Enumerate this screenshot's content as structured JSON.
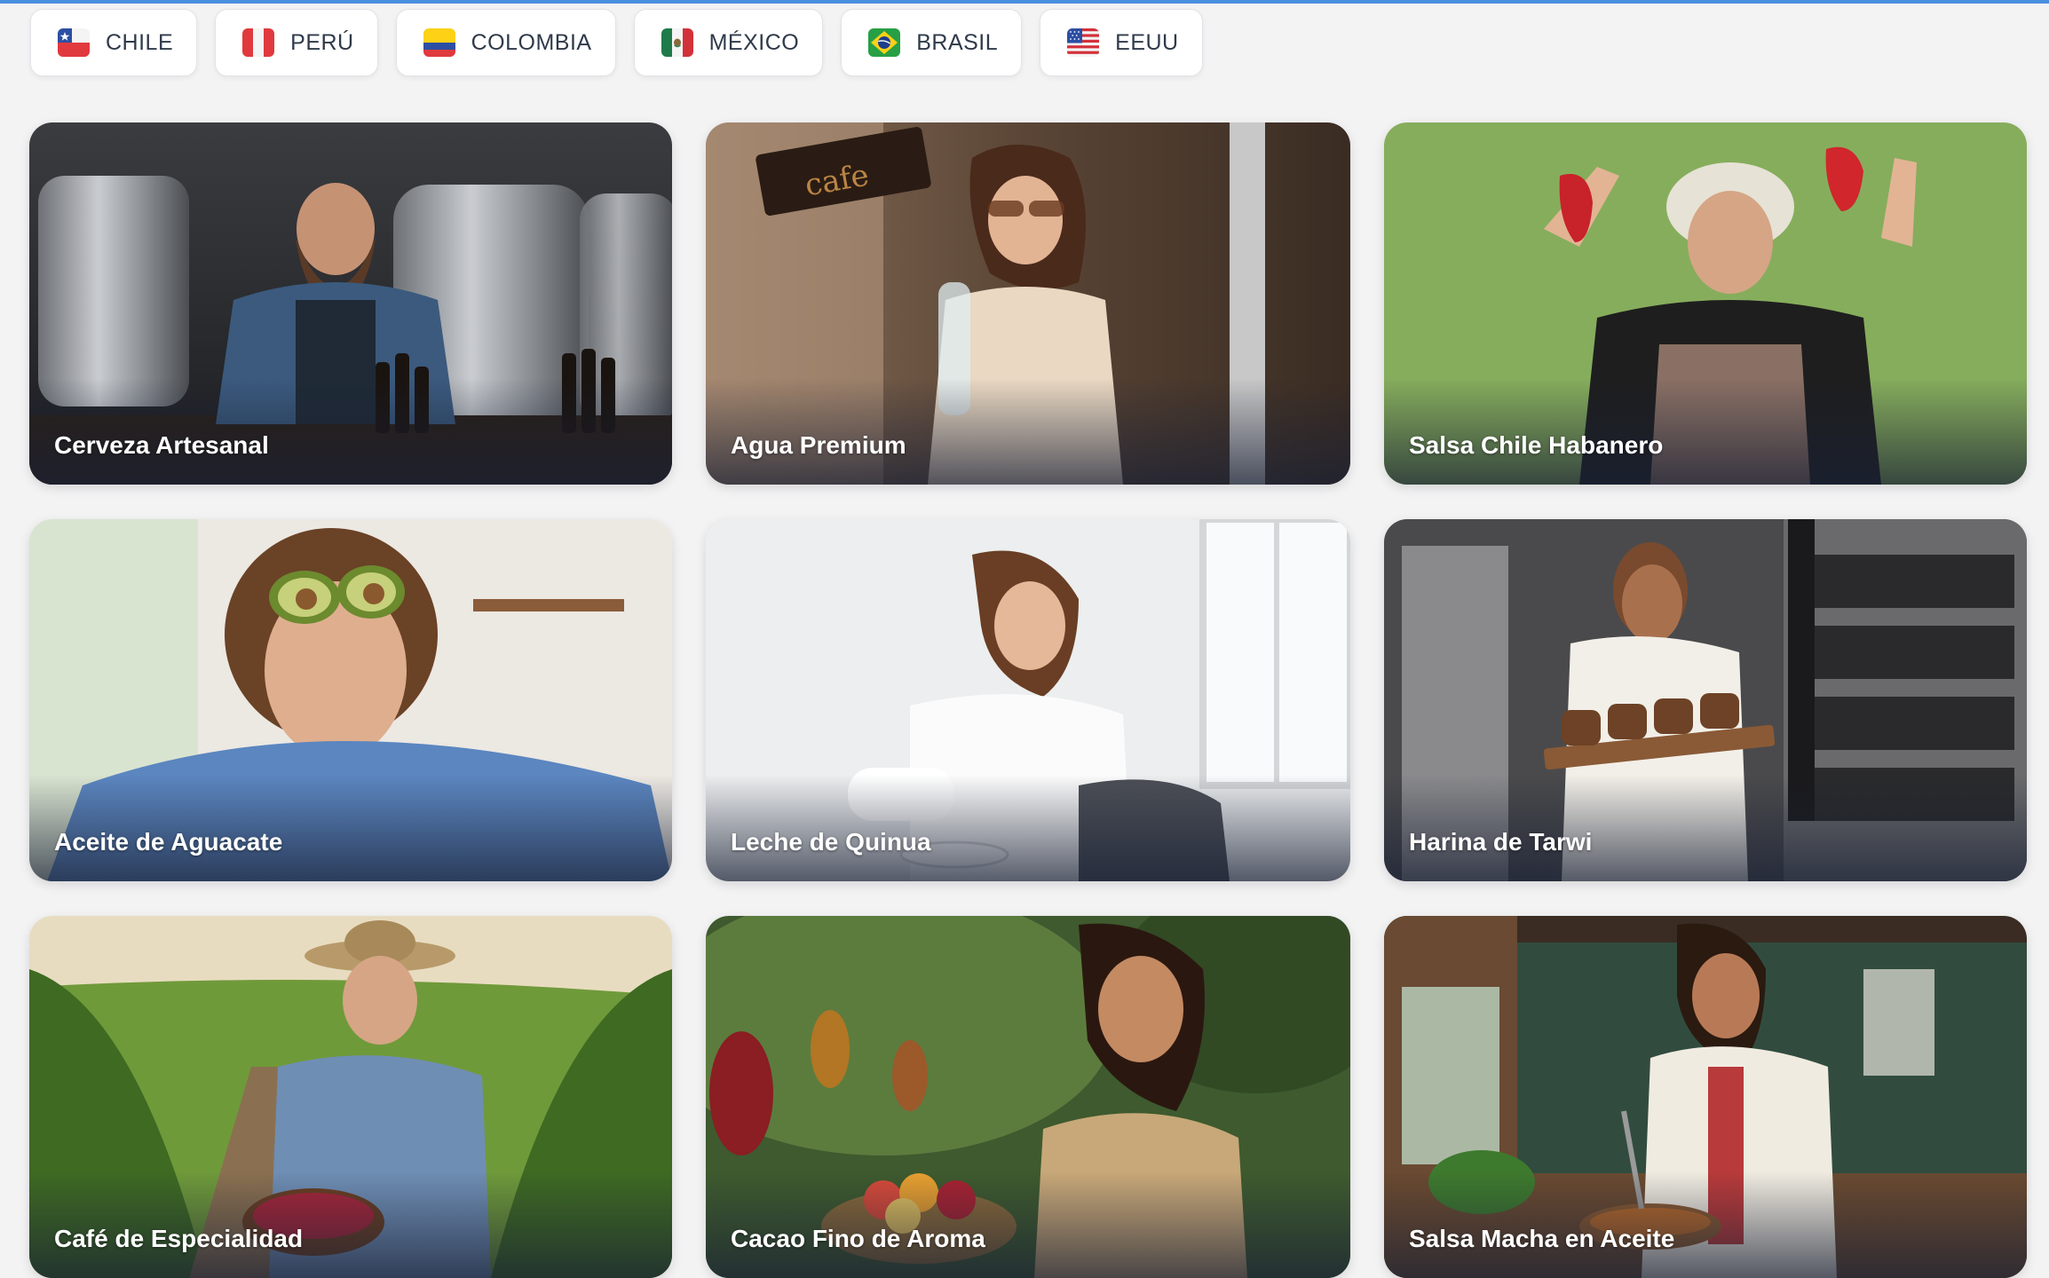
{
  "countries": [
    {
      "label": "CHILE",
      "icon": "chile-flag-icon"
    },
    {
      "label": "PERÚ",
      "icon": "peru-flag-icon"
    },
    {
      "label": "COLOMBIA",
      "icon": "colombia-flag-icon"
    },
    {
      "label": "MÉXICO",
      "icon": "mexico-flag-icon"
    },
    {
      "label": "BRASIL",
      "icon": "brasil-flag-icon"
    },
    {
      "label": "EEUU",
      "icon": "usa-flag-icon"
    }
  ],
  "products": [
    {
      "title": "Cerveza Artesanal"
    },
    {
      "title": "Agua Premium"
    },
    {
      "title": "Salsa Chile Habanero"
    },
    {
      "title": "Aceite de Aguacate"
    },
    {
      "title": "Leche de Quinua"
    },
    {
      "title": "Harina de Tarwi"
    },
    {
      "title": "Café de Especialidad"
    },
    {
      "title": "Cacao Fino de Aroma"
    },
    {
      "title": "Salsa Macha en Aceite"
    }
  ],
  "colors": {
    "accent_line": "#4a8fe0",
    "page_background": "#f3f3f4",
    "button_background": "#ffffff",
    "button_text": "#2f3a4a",
    "card_title": "#ffffff"
  }
}
